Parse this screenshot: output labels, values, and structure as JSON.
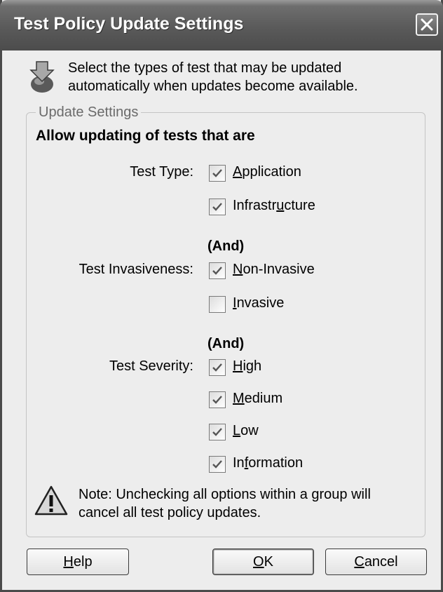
{
  "window": {
    "title": "Test Policy Update Settings",
    "close_icon": "close-icon"
  },
  "intro": {
    "icon": "download-arrow-icon",
    "line1": "Select the types of test that may be updated",
    "line2": "automatically when updates become available."
  },
  "group": {
    "legend": "Update Settings",
    "heading": "Allow updating of tests that are",
    "test_type": {
      "label": "Test Type:",
      "options": [
        {
          "label": "Application",
          "checked": true
        },
        {
          "label": "Infrastructure",
          "checked": true
        }
      ]
    },
    "and_label": "(And)",
    "invasiveness": {
      "label": "Test Invasiveness:",
      "options": [
        {
          "label": "Non-Invasive",
          "checked": true
        },
        {
          "label": "Invasive",
          "checked": false
        }
      ]
    },
    "severity": {
      "label": "Test Severity:",
      "options": [
        {
          "label": "High",
          "checked": true
        },
        {
          "label": "Medium",
          "checked": true
        },
        {
          "label": "Low",
          "checked": true
        },
        {
          "label": "Information",
          "checked": true
        }
      ]
    },
    "note": {
      "icon": "warning-icon",
      "line1": "Note: Unchecking all options within a group will",
      "line2": "cancel all test policy updates."
    }
  },
  "buttons": {
    "help": "Help",
    "ok": "OK",
    "cancel": "Cancel"
  }
}
